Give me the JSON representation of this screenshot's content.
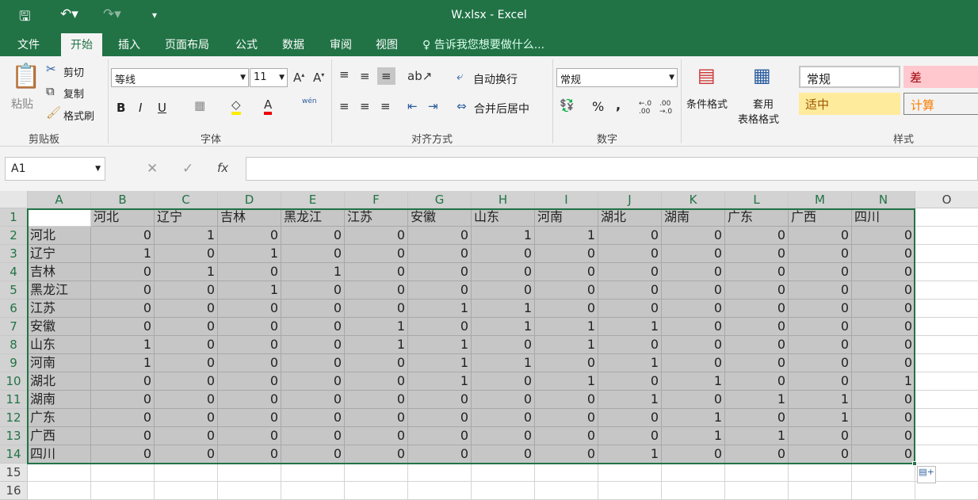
{
  "title": "W.xlsx - Excel",
  "tabs": [
    "文件",
    "开始",
    "插入",
    "页面布局",
    "公式",
    "数据",
    "审阅",
    "视图"
  ],
  "tell_me": "告诉我您想要做什么...",
  "clipboard": {
    "paste": "粘贴",
    "cut": "剪切",
    "copy": "复制",
    "format_painter": "格式刷",
    "label": "剪贴板"
  },
  "font": {
    "name": "等线",
    "size": "11",
    "label": "字体",
    "bold": "B",
    "italic": "I",
    "underline": "U",
    "phonetic": "wén"
  },
  "alignment": {
    "wrap": "自动换行",
    "merge": "合并后居中",
    "label": "对齐方式"
  },
  "number": {
    "format": "常规",
    "percent": "%",
    "comma": ",",
    "label": "数字"
  },
  "styles": {
    "conditional": "条件格式",
    "table_format_1": "套用",
    "table_format_2": "表格格式",
    "normal": "常规",
    "bad": "差",
    "neutral": "适中",
    "calc": "计算",
    "label": "样式"
  },
  "formula_bar": {
    "name_box": "A1",
    "fx": "fx",
    "value": ""
  },
  "colors": {
    "accent": "#217346",
    "selection": "#c6c6c6"
  },
  "sheet": {
    "columns": [
      "A",
      "B",
      "C",
      "D",
      "E",
      "F",
      "G",
      "H",
      "I",
      "J",
      "K",
      "L",
      "M",
      "N",
      "O"
    ],
    "rows": [
      [
        "",
        "河北",
        "辽宁",
        "吉林",
        "黑龙江",
        "江苏",
        "安徽",
        "山东",
        "河南",
        "湖北",
        "湖南",
        "广东",
        "广西",
        "四川"
      ],
      [
        "河北",
        0,
        1,
        0,
        0,
        0,
        0,
        1,
        1,
        0,
        0,
        0,
        0,
        0
      ],
      [
        "辽宁",
        1,
        0,
        1,
        0,
        0,
        0,
        0,
        0,
        0,
        0,
        0,
        0,
        0
      ],
      [
        "吉林",
        0,
        1,
        0,
        1,
        0,
        0,
        0,
        0,
        0,
        0,
        0,
        0,
        0
      ],
      [
        "黑龙江",
        0,
        0,
        1,
        0,
        0,
        0,
        0,
        0,
        0,
        0,
        0,
        0,
        0
      ],
      [
        "江苏",
        0,
        0,
        0,
        0,
        0,
        1,
        1,
        0,
        0,
        0,
        0,
        0,
        0
      ],
      [
        "安徽",
        0,
        0,
        0,
        0,
        1,
        0,
        1,
        1,
        1,
        0,
        0,
        0,
        0
      ],
      [
        "山东",
        1,
        0,
        0,
        0,
        1,
        1,
        0,
        1,
        0,
        0,
        0,
        0,
        0
      ],
      [
        "河南",
        1,
        0,
        0,
        0,
        0,
        1,
        1,
        0,
        1,
        0,
        0,
        0,
        0
      ],
      [
        "湖北",
        0,
        0,
        0,
        0,
        0,
        1,
        0,
        1,
        0,
        1,
        0,
        0,
        1
      ],
      [
        "湖南",
        0,
        0,
        0,
        0,
        0,
        0,
        0,
        0,
        1,
        0,
        1,
        1,
        0
      ],
      [
        "广东",
        0,
        0,
        0,
        0,
        0,
        0,
        0,
        0,
        0,
        1,
        0,
        1,
        0
      ],
      [
        "广西",
        0,
        0,
        0,
        0,
        0,
        0,
        0,
        0,
        0,
        1,
        1,
        0,
        0
      ],
      [
        "四川",
        0,
        0,
        0,
        0,
        0,
        0,
        0,
        0,
        1,
        0,
        0,
        0,
        0
      ]
    ],
    "row_numbers": [
      "1",
      "2",
      "3",
      "4",
      "5",
      "6",
      "7",
      "8",
      "9",
      "10",
      "11",
      "12",
      "13",
      "14",
      "15",
      "16"
    ]
  }
}
